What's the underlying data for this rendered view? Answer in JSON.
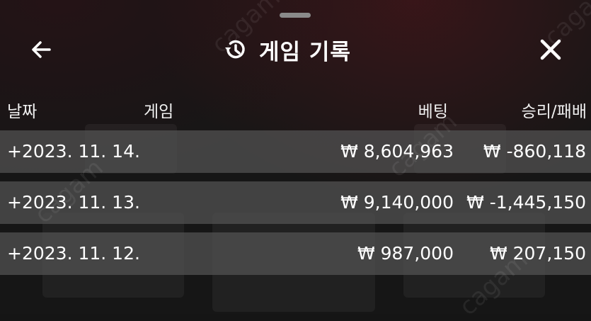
{
  "header": {
    "title": "게임 기록",
    "back_icon": "arrow-left-icon",
    "history_icon": "history-icon",
    "close_icon": "close-icon"
  },
  "columns": {
    "date": "날짜",
    "game": "게임",
    "bet": "베팅",
    "result": "승리/패배"
  },
  "rows": [
    {
      "date": "+2023. 11. 14.",
      "game": "",
      "bet": "₩ 8,604,963",
      "result": "₩ -860,118"
    },
    {
      "date": "+2023. 11. 13.",
      "game": "",
      "bet": "₩ 9,140,000",
      "result": "₩ -1,445,150"
    },
    {
      "date": "+2023. 11. 12.",
      "game": "",
      "bet": "₩ 987,000",
      "result": "₩ 207,150"
    }
  ],
  "colors": {
    "background": "#151515",
    "row_background": "#505050",
    "text": "#ffffff"
  }
}
